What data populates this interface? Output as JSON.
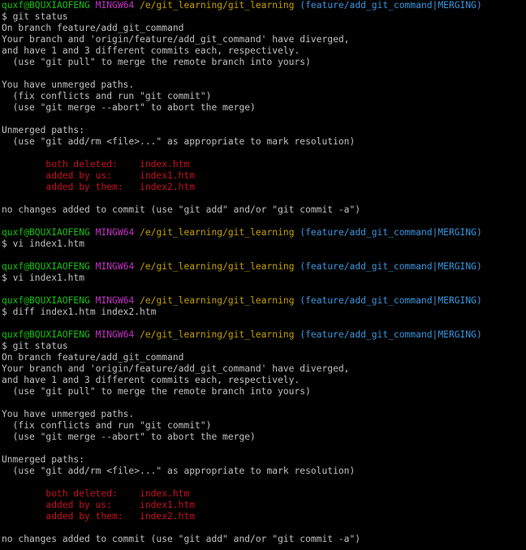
{
  "colors": {
    "background": "#000000",
    "default_text": "#c0c0c0",
    "user_host": "#13c10e",
    "mingw": "#c433c4",
    "path": "#c4a000",
    "branch": "#3a96dd",
    "conflict": "#c50f1f"
  },
  "lines": [
    {
      "segments": [
        {
          "t": "quxf@BQUXIAOFENG",
          "c": "green"
        },
        {
          "t": " ",
          "c": "default"
        },
        {
          "t": "MINGW64",
          "c": "magenta"
        },
        {
          "t": " ",
          "c": "default"
        },
        {
          "t": "/e/git_learning/git_learning",
          "c": "yellow"
        },
        {
          "t": " ",
          "c": "default"
        },
        {
          "t": "(feature/add_git_command|MERGING)",
          "c": "cyan"
        }
      ]
    },
    {
      "segments": [
        {
          "t": "$ git status",
          "c": "default"
        }
      ]
    },
    {
      "segments": [
        {
          "t": "On branch feature/add_git_command",
          "c": "default"
        }
      ]
    },
    {
      "segments": [
        {
          "t": "Your branch and 'origin/feature/add_git_command' have diverged,",
          "c": "default"
        }
      ]
    },
    {
      "segments": [
        {
          "t": "and have 1 and 3 different commits each, respectively.",
          "c": "default"
        }
      ]
    },
    {
      "segments": [
        {
          "t": "  (use \"git pull\" to merge the remote branch into yours)",
          "c": "default"
        }
      ]
    },
    {
      "segments": [
        {
          "t": "",
          "c": "default"
        }
      ]
    },
    {
      "segments": [
        {
          "t": "You have unmerged paths.",
          "c": "default"
        }
      ]
    },
    {
      "segments": [
        {
          "t": "  (fix conflicts and run \"git commit\")",
          "c": "default"
        }
      ]
    },
    {
      "segments": [
        {
          "t": "  (use \"git merge --abort\" to abort the merge)",
          "c": "default"
        }
      ]
    },
    {
      "segments": [
        {
          "t": "",
          "c": "default"
        }
      ]
    },
    {
      "segments": [
        {
          "t": "Unmerged paths:",
          "c": "default"
        }
      ]
    },
    {
      "segments": [
        {
          "t": "  (use \"git add/rm <file>...\" as appropriate to mark resolution)",
          "c": "default"
        }
      ]
    },
    {
      "segments": [
        {
          "t": "",
          "c": "default"
        }
      ]
    },
    {
      "segments": [
        {
          "t": "        both deleted:    index.htm",
          "c": "red"
        }
      ]
    },
    {
      "segments": [
        {
          "t": "        added by us:     index1.htm",
          "c": "red"
        }
      ]
    },
    {
      "segments": [
        {
          "t": "        added by them:   index2.htm",
          "c": "red"
        }
      ]
    },
    {
      "segments": [
        {
          "t": "",
          "c": "default"
        }
      ]
    },
    {
      "segments": [
        {
          "t": "no changes added to commit (use \"git add\" and/or \"git commit -a\")",
          "c": "default"
        }
      ]
    },
    {
      "segments": [
        {
          "t": "",
          "c": "default"
        }
      ]
    },
    {
      "segments": [
        {
          "t": "quxf@BQUXIAOFENG",
          "c": "green"
        },
        {
          "t": " ",
          "c": "default"
        },
        {
          "t": "MINGW64",
          "c": "magenta"
        },
        {
          "t": " ",
          "c": "default"
        },
        {
          "t": "/e/git_learning/git_learning",
          "c": "yellow"
        },
        {
          "t": " ",
          "c": "default"
        },
        {
          "t": "(feature/add_git_command|MERGING)",
          "c": "cyan"
        }
      ]
    },
    {
      "segments": [
        {
          "t": "$ vi index1.htm",
          "c": "default"
        }
      ]
    },
    {
      "segments": [
        {
          "t": "",
          "c": "default"
        }
      ]
    },
    {
      "segments": [
        {
          "t": "quxf@BQUXIAOFENG",
          "c": "green"
        },
        {
          "t": " ",
          "c": "default"
        },
        {
          "t": "MINGW64",
          "c": "magenta"
        },
        {
          "t": " ",
          "c": "default"
        },
        {
          "t": "/e/git_learning/git_learning",
          "c": "yellow"
        },
        {
          "t": " ",
          "c": "default"
        },
        {
          "t": "(feature/add_git_command|MERGING)",
          "c": "cyan"
        }
      ]
    },
    {
      "segments": [
        {
          "t": "$ vi index1.htm",
          "c": "default"
        }
      ]
    },
    {
      "segments": [
        {
          "t": "",
          "c": "default"
        }
      ]
    },
    {
      "segments": [
        {
          "t": "quxf@BQUXIAOFENG",
          "c": "green"
        },
        {
          "t": " ",
          "c": "default"
        },
        {
          "t": "MINGW64",
          "c": "magenta"
        },
        {
          "t": " ",
          "c": "default"
        },
        {
          "t": "/e/git_learning/git_learning",
          "c": "yellow"
        },
        {
          "t": " ",
          "c": "default"
        },
        {
          "t": "(feature/add_git_command|MERGING)",
          "c": "cyan"
        }
      ]
    },
    {
      "segments": [
        {
          "t": "$ diff index1.htm index2.htm",
          "c": "default"
        }
      ]
    },
    {
      "segments": [
        {
          "t": "",
          "c": "default"
        }
      ]
    },
    {
      "segments": [
        {
          "t": "quxf@BQUXIAOFENG",
          "c": "green"
        },
        {
          "t": " ",
          "c": "default"
        },
        {
          "t": "MINGW64",
          "c": "magenta"
        },
        {
          "t": " ",
          "c": "default"
        },
        {
          "t": "/e/git_learning/git_learning",
          "c": "yellow"
        },
        {
          "t": " ",
          "c": "default"
        },
        {
          "t": "(feature/add_git_command|MERGING)",
          "c": "cyan"
        }
      ]
    },
    {
      "segments": [
        {
          "t": "$ git status",
          "c": "default"
        }
      ]
    },
    {
      "segments": [
        {
          "t": "On branch feature/add_git_command",
          "c": "default"
        }
      ]
    },
    {
      "segments": [
        {
          "t": "Your branch and 'origin/feature/add_git_command' have diverged,",
          "c": "default"
        }
      ]
    },
    {
      "segments": [
        {
          "t": "and have 1 and 3 different commits each, respectively.",
          "c": "default"
        }
      ]
    },
    {
      "segments": [
        {
          "t": "  (use \"git pull\" to merge the remote branch into yours)",
          "c": "default"
        }
      ]
    },
    {
      "segments": [
        {
          "t": "",
          "c": "default"
        }
      ]
    },
    {
      "segments": [
        {
          "t": "You have unmerged paths.",
          "c": "default"
        }
      ]
    },
    {
      "segments": [
        {
          "t": "  (fix conflicts and run \"git commit\")",
          "c": "default"
        }
      ]
    },
    {
      "segments": [
        {
          "t": "  (use \"git merge --abort\" to abort the merge)",
          "c": "default"
        }
      ]
    },
    {
      "segments": [
        {
          "t": "",
          "c": "default"
        }
      ]
    },
    {
      "segments": [
        {
          "t": "Unmerged paths:",
          "c": "default"
        }
      ]
    },
    {
      "segments": [
        {
          "t": "  (use \"git add/rm <file>...\" as appropriate to mark resolution)",
          "c": "default"
        }
      ]
    },
    {
      "segments": [
        {
          "t": "",
          "c": "default"
        }
      ]
    },
    {
      "segments": [
        {
          "t": "        both deleted:    index.htm",
          "c": "red"
        }
      ]
    },
    {
      "segments": [
        {
          "t": "        added by us:     index1.htm",
          "c": "red"
        }
      ]
    },
    {
      "segments": [
        {
          "t": "        added by them:   index2.htm",
          "c": "red"
        }
      ]
    },
    {
      "segments": [
        {
          "t": "",
          "c": "default"
        }
      ]
    },
    {
      "segments": [
        {
          "t": "no changes added to commit (use \"git add\" and/or \"git commit -a\")",
          "c": "default"
        }
      ]
    }
  ]
}
